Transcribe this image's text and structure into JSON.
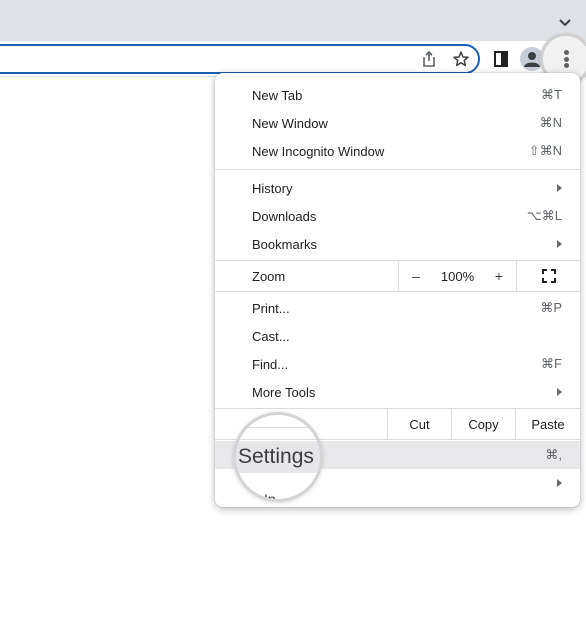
{
  "browser": {
    "toolbar_icons": {
      "tab_search": "chevron-down-icon",
      "share": "share-icon",
      "bookmark": "star-icon",
      "side_panel": "side-panel-icon",
      "profile": "profile-icon",
      "menu": "three-dot-menu-icon"
    },
    "accent_color": "#1a5fb4"
  },
  "menu": {
    "group1": [
      {
        "label": "New Tab",
        "shortcut": "⌘T"
      },
      {
        "label": "New Window",
        "shortcut": "⌘N"
      },
      {
        "label": "New Incognito Window",
        "shortcut": "⇧⌘N"
      }
    ],
    "group2": [
      {
        "label": "History",
        "submenu": true
      },
      {
        "label": "Downloads",
        "shortcut": "⌥⌘L"
      },
      {
        "label": "Bookmarks",
        "submenu": true
      }
    ],
    "zoom": {
      "label": "Zoom",
      "minus": "–",
      "value": "100%",
      "plus": "+",
      "fullscreen_icon": "fullscreen-icon"
    },
    "group3": [
      {
        "label": "Print...",
        "shortcut": "⌘P"
      },
      {
        "label": "Cast..."
      },
      {
        "label": "Find...",
        "shortcut": "⌘F"
      },
      {
        "label": "More Tools",
        "submenu": true
      }
    ],
    "edit": {
      "cut": "Cut",
      "copy": "Copy",
      "paste": "Paste"
    },
    "settings": {
      "label": "Settings",
      "shortcut": "⌘,",
      "highlighted": true
    },
    "help": {
      "label": "Help",
      "submenu": true,
      "visible_fragment": "Ip"
    }
  }
}
